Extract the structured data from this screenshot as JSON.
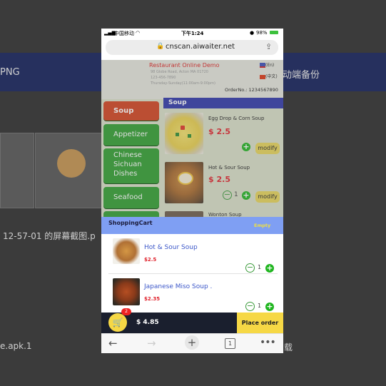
{
  "background": {
    "png_label": "PNG",
    "right_label": "动端备份",
    "screenshot_caption": "12-57-01 的屏幕截图.p",
    "apk_label": "e.apk.1",
    "right_fragment": "载"
  },
  "status_bar": {
    "carrier": "中国移动",
    "time": "下午1:24",
    "battery": "98%"
  },
  "browser": {
    "url": "cnscan.aiwaiter.net",
    "tabs_count": "1"
  },
  "restaurant": {
    "name": "Restaurant Online Demo",
    "address_line1": "98 Globe Road, Acton MA 01720",
    "address_line2": "123-456-7890",
    "hours": "Thursday-Sunday(11:00am-9:00pm)",
    "order_no": "OrderNo.: 1234567890"
  },
  "languages": [
    "(En)",
    "(中文)"
  ],
  "sidebar": {
    "items": [
      {
        "label": "Soup",
        "active": true
      },
      {
        "label": "Appetizer"
      },
      {
        "label": "Chinese Sichuan Dishes",
        "lines": [
          "Chinese",
          "Sichuan",
          "Dishes"
        ]
      },
      {
        "label": "Seafood"
      }
    ]
  },
  "category": {
    "title": "Soup"
  },
  "dishes": [
    {
      "name": "Egg Drop & Corn Soup",
      "price": "$ 2.5",
      "modify": "modify"
    },
    {
      "name": "Hot & Sour Soup",
      "price": "$ 2.5",
      "qty": "1",
      "modify": "modify"
    },
    {
      "name": "Wonton Soup"
    }
  ],
  "cart": {
    "title": "ShoppingCart",
    "empty_label": "Empty",
    "items": [
      {
        "name": "Hot & Sour Soup",
        "price": "$2.5",
        "qty": "1"
      },
      {
        "name": "Japanese Miso Soup .",
        "price": "$2.35",
        "qty": "1"
      }
    ],
    "badge_count": "2",
    "total": "$ 4.85",
    "place_order": "Place order"
  },
  "colors": {
    "sidebar_green": "#2e9e2e",
    "active_red": "#d2401c",
    "category_blue": "#2c35a8",
    "cart_blue": "#7f9ff3",
    "price_red": "#e0202a",
    "accent_yellow": "#f6d845"
  }
}
